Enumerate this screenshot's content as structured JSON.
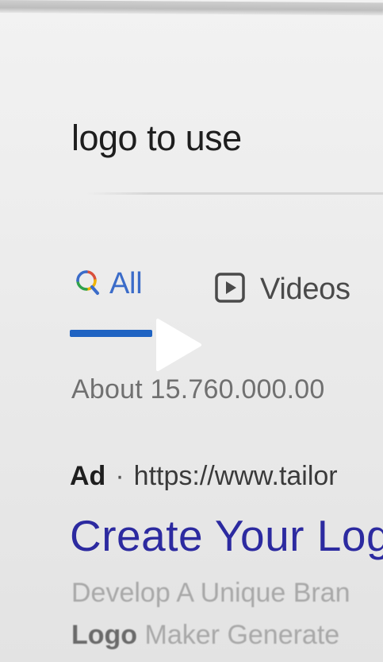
{
  "search": {
    "query": "logo to use"
  },
  "tabs": [
    {
      "label": "All",
      "icon": "search-icon",
      "active": true
    },
    {
      "label": "Videos",
      "icon": "video-play-icon",
      "active": false
    }
  ],
  "colors": {
    "active_tab": "#1f63c2",
    "ad_title": "#2c2aa0"
  },
  "results": {
    "count_text": "About 15.760.000.00"
  },
  "ad": {
    "badge": "Ad",
    "separator": "·",
    "url": "https://www.tailor",
    "title": "Create Your Log",
    "description_line1": "Develop A Unique Bran",
    "description_line2_bold": "Logo",
    "description_line2_rest": "Maker Generate"
  },
  "overlay": {
    "icon": "play-icon"
  }
}
